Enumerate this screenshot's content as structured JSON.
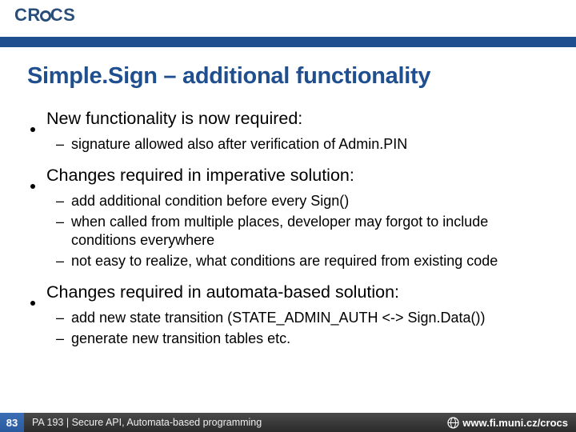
{
  "header": {
    "logo_text_pre": "CR",
    "logo_text_post": "CS"
  },
  "title": "Simple.Sign – additional functionality",
  "bullets": [
    {
      "text": "New functionality is now required:",
      "sub": [
        "signature allowed also after verification of Admin.PIN"
      ]
    },
    {
      "text": "Changes required in imperative solution:",
      "sub": [
        "add additional condition before every Sign()",
        "when called from multiple places, developer may forgot to include conditions everywhere",
        "not easy to realize, what conditions are required from existing code"
      ]
    },
    {
      "text": "Changes required in automata-based solution:",
      "sub": [
        "add new state transition (STATE_ADMIN_AUTH <-> Sign.Data())",
        "generate new transition tables etc."
      ]
    }
  ],
  "footer": {
    "page": "83",
    "course": "PA 193 | Secure API, Automata-based programming",
    "url": "www.fi.muni.cz/crocs"
  }
}
